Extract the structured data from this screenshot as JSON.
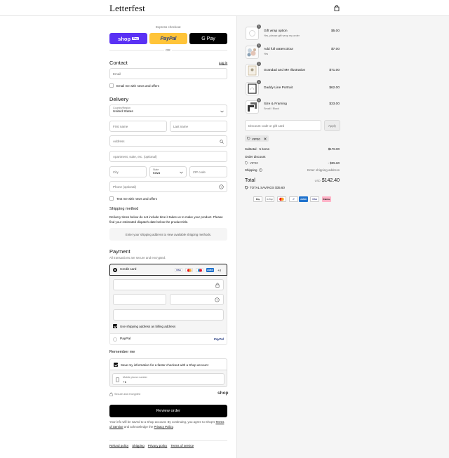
{
  "header": {
    "brand": "Letterfest"
  },
  "express": {
    "label": "Express checkout",
    "shop_label": "shop",
    "shop_pay_label": "Pay",
    "paypal_label": "PayPal",
    "gpay_label": "G Pay",
    "or_label": "OR"
  },
  "contact": {
    "title": "Contact",
    "login_link": "Log in",
    "email_placeholder": "Email",
    "news_label": "Email me with news and offers"
  },
  "delivery": {
    "title": "Delivery",
    "country_label": "Country/Region",
    "country_value": "United States",
    "first_name_placeholder": "First name",
    "last_name_placeholder": "Last name",
    "address_placeholder": "Address",
    "apt_placeholder": "Apartment, suite, etc. (optional)",
    "city_placeholder": "City",
    "state_label": "State",
    "state_value": "Iowa",
    "zip_placeholder": "ZIP code",
    "phone_placeholder": "Phone (optional)",
    "text_label": "Text me with news and offers"
  },
  "shipping_method": {
    "title": "Shipping method",
    "notice": "Delivery times below do not include time it takes us to make your product. Please find your estimated dispatch date below the product title.",
    "placeholder": "Enter your shipping address to view available shipping methods."
  },
  "payment": {
    "title": "Payment",
    "subtitle": "All transactions are secure and encrypted.",
    "credit_card_label": "Credit card",
    "card_logos": [
      "VISA",
      "MC",
      "MAE",
      "AMEX"
    ],
    "more_label": "+4",
    "billing_label": "Use shipping address as billing address",
    "paypal_label": "PayPal",
    "paypal_logo": "PayPal"
  },
  "remember": {
    "title": "Remember me",
    "save_label": "Save my information for a faster checkout with a Shop account",
    "mobile_label": "Mobile phone number",
    "mobile_value": "+1",
    "secure_label": "Secure and encrypted",
    "shop_logo": "shop"
  },
  "review": {
    "button_label": "Review order",
    "legal_prefix": "Your info will be saved to a Shop account. By continuing, you agree to Shop's",
    "terms_link": "Terms of Service",
    "legal_mid": "and acknowledge the",
    "privacy_link": "Privacy Policy",
    "legal_end": "."
  },
  "footer": {
    "links": [
      "Refund policy",
      "Shipping",
      "Privacy policy",
      "Terms of service"
    ]
  },
  "cart": {
    "items": [
      {
        "name": "Gift wrap option",
        "sub": "Yes, please gift wrap my order",
        "price": "$5.00",
        "qty": "1"
      },
      {
        "name": "Add full watercolour",
        "sub": "Yes",
        "price": "$7.00",
        "qty": "1"
      },
      {
        "name": "Grandad and Me Illustration",
        "sub": "",
        "price": "$71.00",
        "qty": "1"
      },
      {
        "name": "Daddy Line Portrait",
        "sub": "",
        "price": "$62.00",
        "qty": "1"
      },
      {
        "name": "Size & Framing",
        "sub": "Small / Black",
        "price": "$33.00",
        "qty": "1"
      }
    ],
    "discount_placeholder": "Discount code or gift card",
    "apply_label": "Apply",
    "applied_code": "VIP20",
    "subtotal_label": "Subtotal · 5 items",
    "subtotal_value": "$178.00",
    "order_discount_label": "Order discount",
    "discount_code_label": "VIP20",
    "discount_value": "- $35.60",
    "shipping_label": "Shipping",
    "shipping_value": "Enter shipping address",
    "total_label": "Total",
    "currency": "USD",
    "total_value": "$142.40",
    "savings_label": "TOTAL SAVINGS",
    "savings_value": "$35.60",
    "payment_badges": [
      "Pay",
      "G Pay",
      "MC",
      "P",
      "AMEX",
      "VISA",
      "Klarna."
    ]
  },
  "colors": {
    "shop_purple": "#5a31f4",
    "paypal_yellow": "#ffc439",
    "primary_button": "#000000",
    "sidebar_bg": "#f5f5f5"
  }
}
